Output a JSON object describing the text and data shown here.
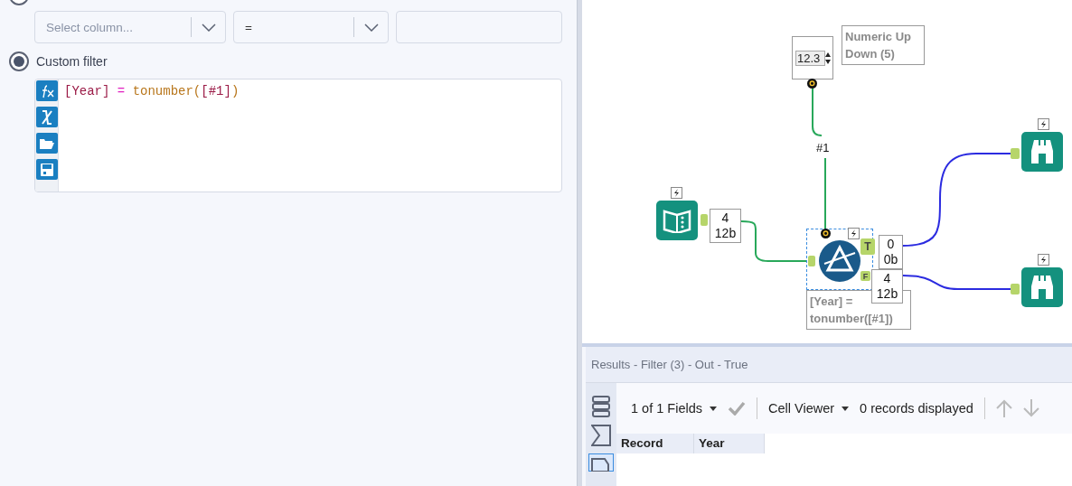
{
  "filter_panel": {
    "column_select": {
      "placeholder": "Select column..."
    },
    "operator_select": {
      "value": "="
    },
    "custom_filter": {
      "label": "Custom filter",
      "selected": true
    },
    "basic_filter": {
      "selected": false
    },
    "expression": [
      {
        "text": "[Year]",
        "kind": "field"
      },
      {
        "text": " = ",
        "kind": "operator"
      },
      {
        "text": "tonumber(",
        "kind": "function"
      },
      {
        "text": "[#1]",
        "kind": "field"
      },
      {
        "text": ")",
        "kind": "function"
      }
    ]
  },
  "canvas": {
    "numeric_tool": {
      "value": "12.3",
      "annotation": "Numeric Up Down (5)"
    },
    "question_link": {
      "label": "#1"
    },
    "input_tool": {
      "count": "4",
      "size": "12b"
    },
    "filter_tool": {
      "selected": true,
      "annotation": "[Year] = tonumber([#1])",
      "outputs": [
        {
          "label": "T",
          "count": "0",
          "size": "0b"
        },
        {
          "label": "F",
          "count": "4",
          "size": "12b"
        }
      ]
    }
  },
  "results": {
    "title": "Results - Filter (3) - Out - True",
    "fields_menu": "1 of 1 Fields",
    "viewer_menu": "Cell Viewer",
    "records": "0 records displayed",
    "columns": [
      "Record",
      "Year"
    ]
  }
}
